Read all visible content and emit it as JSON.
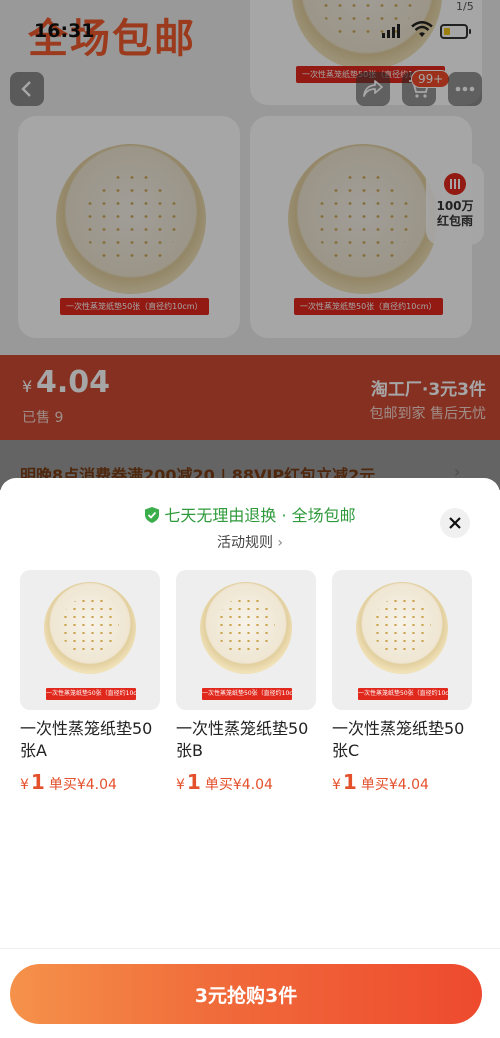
{
  "status_bar": {
    "time": "16:31"
  },
  "gallery": {
    "counter": "1/5",
    "banner": "全场包邮"
  },
  "nav": {
    "cart_badge": "99+"
  },
  "product_tag": "一次性蒸笼纸垫50张（直径约10cm）",
  "red_rain": {
    "line1": "100万",
    "line2": "红包雨"
  },
  "price_bar": {
    "currency": "¥",
    "price": "4.04",
    "sold": "已售 9",
    "brand": "淘工厂·3元3件",
    "slogan": "包邮到家 售后无忧"
  },
  "promo": {
    "text": "明晚8点消费券满200减20 | 88VIP红包立减2元"
  },
  "sheet": {
    "assurance": "七天无理由退换 · 全场包邮",
    "rules_label": "活动规则",
    "products": [
      {
        "name": "一次性蒸笼纸垫50张A",
        "currency": "¥",
        "price": "1",
        "single": "单买¥4.04",
        "tag": "一次性蒸笼纸垫50张（直径约10cm）"
      },
      {
        "name": "一次性蒸笼纸垫50张B",
        "currency": "¥",
        "price": "1",
        "single": "单买¥4.04",
        "tag": "一次性蒸笼纸垫50张（直径约10cm）"
      },
      {
        "name": "一次性蒸笼纸垫50张C",
        "currency": "¥",
        "price": "1",
        "single": "单买¥4.04",
        "tag": "一次性蒸笼纸垫50张（直径约10cm）"
      }
    ],
    "buy_button": "3元抢购3件"
  },
  "colors": {
    "accent": "#ee4a2e",
    "green": "#2f9a3c",
    "price_red": "#e4502b"
  }
}
